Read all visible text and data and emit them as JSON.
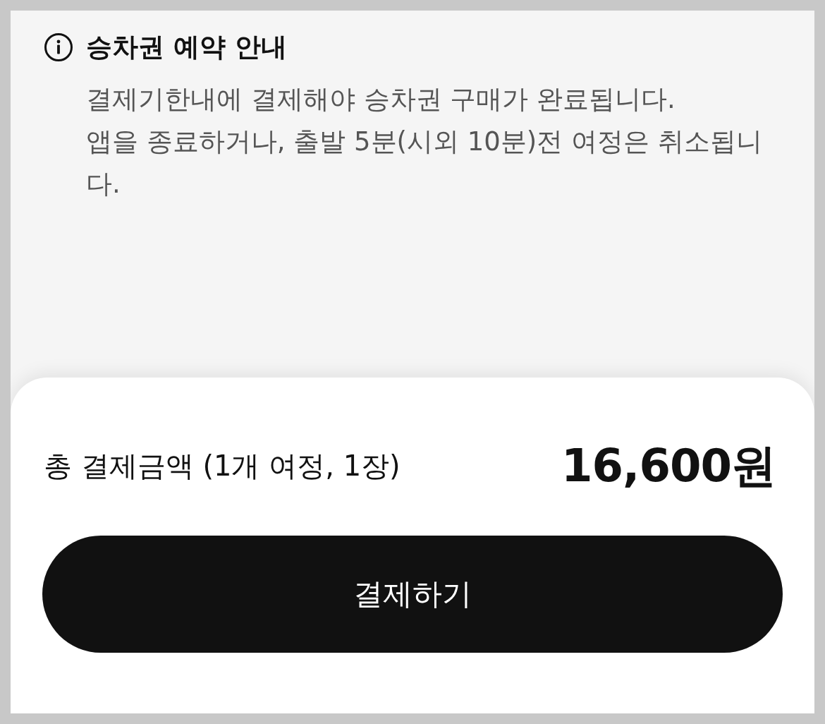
{
  "notice": {
    "title": "승차권 예약 안내",
    "lines": [
      "결제기한내에 결제해야 승차권 구매가 완료됩니다.",
      "앱을 종료하거나, 출발 5분(시외 10분)전 여정은 취소됩니다."
    ]
  },
  "summary": {
    "label": "총 결제금액 (1개 여정, 1장)",
    "amount": "16,600원"
  },
  "pay_button": {
    "label": "결제하기"
  }
}
